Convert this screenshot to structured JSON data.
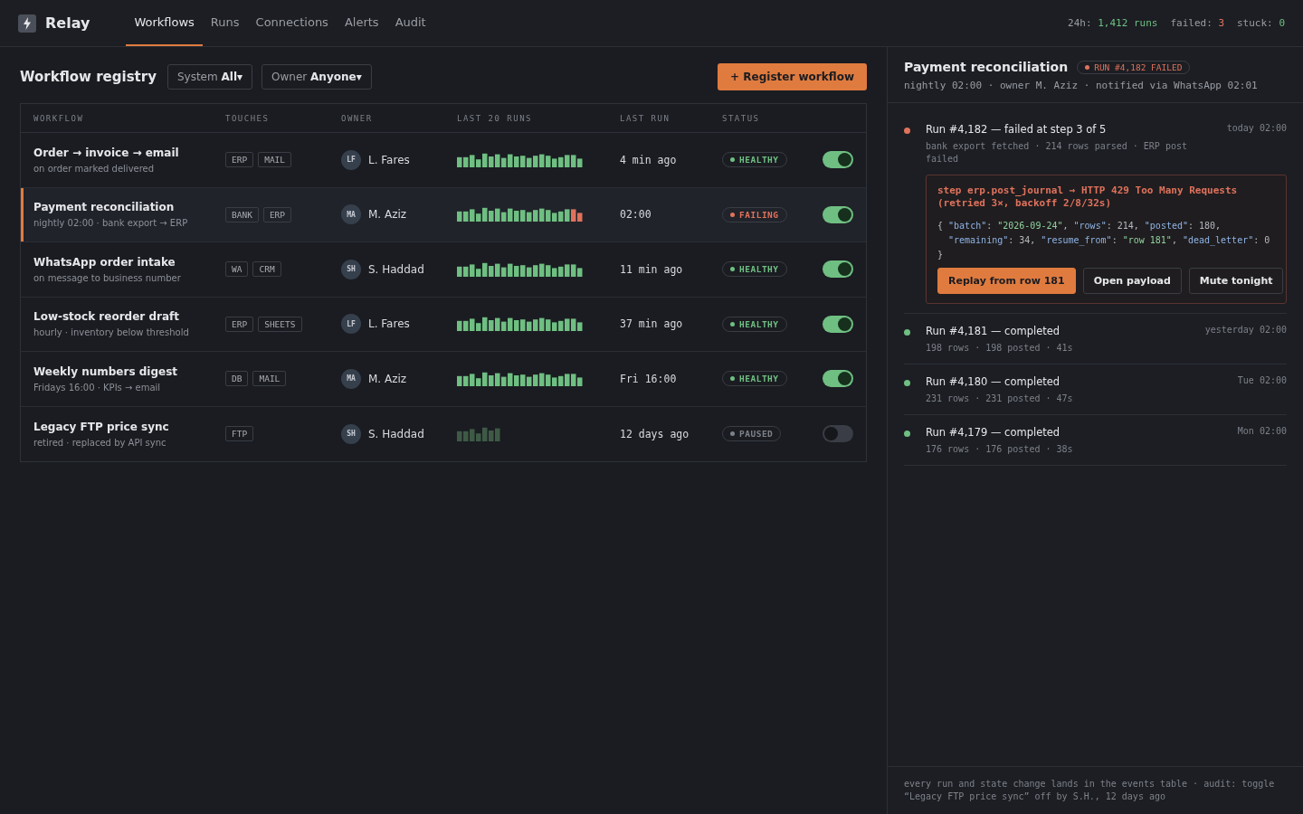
{
  "app": {
    "name": "Relay"
  },
  "nav": [
    {
      "label": "Workflows",
      "selected": true
    },
    {
      "label": "Runs",
      "selected": false
    },
    {
      "label": "Connections",
      "selected": false
    },
    {
      "label": "Alerts",
      "selected": false
    },
    {
      "label": "Audit",
      "selected": false
    }
  ],
  "stats": [
    {
      "label": "24h:",
      "value": "1,412 runs",
      "kind": "ok"
    },
    {
      "label": "failed:",
      "value": "3",
      "kind": "bad"
    },
    {
      "label": "stuck:",
      "value": "0",
      "kind": "ok"
    }
  ],
  "registry": {
    "title": "Workflow registry",
    "filters": [
      {
        "label": "System",
        "value": "All",
        "caret": "▾"
      },
      {
        "label": "Owner",
        "value": "Anyone",
        "caret": "▾"
      }
    ],
    "register_button": "+ Register workflow",
    "columns": [
      "WORKFLOW",
      "TOUCHES",
      "OWNER",
      "LAST 20 RUNS",
      "LAST RUN",
      "STATUS"
    ],
    "rows": [
      {
        "name": "Order → invoice → email",
        "trigger": "on order marked delivered",
        "touches": [
          "ERP",
          "MAIL"
        ],
        "initials": "LF",
        "owner": "L. Fares",
        "recent": [
          {
            "failed": false
          },
          {
            "failed": false
          },
          {
            "failed": false
          },
          {
            "failed": false
          },
          {
            "failed": false
          },
          {
            "failed": false
          },
          {
            "failed": false
          },
          {
            "failed": false
          },
          {
            "failed": false
          },
          {
            "failed": false
          },
          {
            "failed": false
          },
          {
            "failed": false
          },
          {
            "failed": false
          },
          {
            "failed": false
          },
          {
            "failed": false
          },
          {
            "failed": false
          },
          {
            "failed": false
          },
          {
            "failed": false
          },
          {
            "failed": false
          },
          {
            "failed": false
          }
        ],
        "last_run": "4 min ago",
        "status": {
          "label": "HEALTHY",
          "kind": "healthy"
        },
        "on": true,
        "selected": false
      },
      {
        "name": "Payment reconciliation",
        "trigger": "nightly 02:00 · bank export → ERP",
        "touches": [
          "BANK",
          "ERP"
        ],
        "initials": "MA",
        "owner": "M. Aziz",
        "recent": [
          {
            "failed": false
          },
          {
            "failed": false
          },
          {
            "failed": false
          },
          {
            "failed": false
          },
          {
            "failed": false
          },
          {
            "failed": false
          },
          {
            "failed": false
          },
          {
            "failed": false
          },
          {
            "failed": false
          },
          {
            "failed": false
          },
          {
            "failed": false
          },
          {
            "failed": false
          },
          {
            "failed": false
          },
          {
            "failed": false
          },
          {
            "failed": false
          },
          {
            "failed": false
          },
          {
            "failed": false
          },
          {
            "failed": false
          },
          {
            "failed": true
          },
          {
            "failed": true
          }
        ],
        "last_run": "02:00",
        "status": {
          "label": "FAILING",
          "kind": "failing"
        },
        "on": true,
        "selected": true
      },
      {
        "name": "WhatsApp order intake",
        "trigger": "on message to business number",
        "touches": [
          "WA",
          "CRM"
        ],
        "initials": "SH",
        "owner": "S. Haddad",
        "recent": [
          {
            "failed": false
          },
          {
            "failed": false
          },
          {
            "failed": false
          },
          {
            "failed": false
          },
          {
            "failed": false
          },
          {
            "failed": false
          },
          {
            "failed": false
          },
          {
            "failed": false
          },
          {
            "failed": false
          },
          {
            "failed": false
          },
          {
            "failed": false
          },
          {
            "failed": false
          },
          {
            "failed": false
          },
          {
            "failed": false
          },
          {
            "failed": false
          },
          {
            "failed": false
          },
          {
            "failed": false
          },
          {
            "failed": false
          },
          {
            "failed": false
          },
          {
            "failed": false
          }
        ],
        "last_run": "11 min ago",
        "status": {
          "label": "HEALTHY",
          "kind": "healthy"
        },
        "on": true,
        "selected": false
      },
      {
        "name": "Low-stock reorder draft",
        "trigger": "hourly · inventory below threshold",
        "touches": [
          "ERP",
          "SHEETS"
        ],
        "initials": "LF",
        "owner": "L. Fares",
        "recent": [
          {
            "failed": false
          },
          {
            "failed": false
          },
          {
            "failed": false
          },
          {
            "failed": false
          },
          {
            "failed": false
          },
          {
            "failed": false
          },
          {
            "failed": false
          },
          {
            "failed": false
          },
          {
            "failed": false
          },
          {
            "failed": false
          },
          {
            "failed": false
          },
          {
            "failed": false
          },
          {
            "failed": false
          },
          {
            "failed": false
          },
          {
            "failed": false
          },
          {
            "failed": false
          },
          {
            "failed": false
          },
          {
            "failed": false
          },
          {
            "failed": false
          },
          {
            "failed": false
          }
        ],
        "last_run": "37 min ago",
        "status": {
          "label": "HEALTHY",
          "kind": "healthy"
        },
        "on": true,
        "selected": false
      },
      {
        "name": "Weekly numbers digest",
        "trigger": "Fridays 16:00 · KPIs → email",
        "touches": [
          "DB",
          "MAIL"
        ],
        "initials": "MA",
        "owner": "M. Aziz",
        "recent": [
          {
            "failed": false
          },
          {
            "failed": false
          },
          {
            "failed": false
          },
          {
            "failed": false
          },
          {
            "failed": false
          },
          {
            "failed": false
          },
          {
            "failed": false
          },
          {
            "failed": false
          },
          {
            "failed": false
          },
          {
            "failed": false
          },
          {
            "failed": false
          },
          {
            "failed": false
          },
          {
            "failed": false
          },
          {
            "failed": false
          },
          {
            "failed": false
          },
          {
            "failed": false
          },
          {
            "failed": false
          },
          {
            "failed": false
          },
          {
            "failed": false
          },
          {
            "failed": false
          }
        ],
        "last_run": "Fri 16:00",
        "status": {
          "label": "HEALTHY",
          "kind": "healthy"
        },
        "on": true,
        "selected": false
      },
      {
        "name": "Legacy FTP price sync",
        "trigger": "retired · replaced by API sync",
        "touches": [
          "FTP"
        ],
        "initials": "SH",
        "owner": "S. Haddad",
        "recent": [
          {
            "failed": false
          },
          {
            "failed": false
          },
          {
            "failed": false
          },
          {
            "failed": false
          },
          {
            "failed": false
          },
          {
            "failed": false
          },
          {
            "failed": false
          }
        ],
        "last_run": "12 days ago",
        "status": {
          "label": "PAUSED",
          "kind": "paused"
        },
        "on": false,
        "selected": false
      }
    ]
  },
  "detail": {
    "title": "Payment reconciliation",
    "badge": "RUN #4,182 FAILED",
    "subtitle": "nightly 02:00 · owner M. Aziz · notified via WhatsApp 02:01",
    "runs": [
      {
        "title": "Run #4,182 — failed at step 3 of 5",
        "time": "today 02:00",
        "summary": "bank export fetched · 214 rows parsed · ERP post failed",
        "kind": "failed",
        "error": {
          "message": "step erp.post_journal → HTTP 429 Too Many Requests (retried 3×, backoff 2/8/32s)",
          "payload": [
            {
              "indent": false,
              "tokens": [
                {
                  "t": "{ ",
                  "kind": "punct"
                },
                {
                  "t": "\"batch\"",
                  "kind": "key"
                },
                {
                  "t": ": ",
                  "kind": "punct"
                },
                {
                  "t": "\"2026-09-24\"",
                  "kind": "str"
                },
                {
                  "t": ", ",
                  "kind": "punct"
                },
                {
                  "t": "\"rows\"",
                  "kind": "key"
                },
                {
                  "t": ": 214, ",
                  "kind": "punct"
                },
                {
                  "t": "\"posted\"",
                  "kind": "key"
                },
                {
                  "t": ": 180,",
                  "kind": "punct"
                }
              ]
            },
            {
              "indent": true,
              "tokens": [
                {
                  "t": "\"remaining\"",
                  "kind": "key"
                },
                {
                  "t": ": 34, ",
                  "kind": "punct"
                },
                {
                  "t": "\"resume_from\"",
                  "kind": "key"
                },
                {
                  "t": ": ",
                  "kind": "punct"
                },
                {
                  "t": "\"row 181\"",
                  "kind": "str"
                },
                {
                  "t": ", ",
                  "kind": "punct"
                },
                {
                  "t": "\"dead_letter\"",
                  "kind": "key"
                },
                {
                  "t": ": 0",
                  "kind": "punct"
                }
              ]
            },
            {
              "indent": false,
              "tokens": [
                {
                  "t": "}",
                  "kind": "punct"
                }
              ]
            }
          ],
          "actions": [
            {
              "label": "Replay from row 181",
              "kind": "primary"
            },
            {
              "label": "Open payload",
              "kind": "secondary"
            },
            {
              "label": "Mute tonight",
              "kind": "secondary"
            }
          ]
        }
      },
      {
        "title": "Run #4,181 — completed",
        "time": "yesterday 02:00",
        "summary": "198 rows · 198 posted · 41s",
        "kind": "completed"
      },
      {
        "title": "Run #4,180 — completed",
        "time": "Tue 02:00",
        "summary": "231 rows · 231 posted · 47s",
        "kind": "completed"
      },
      {
        "title": "Run #4,179 — completed",
        "time": "Mon 02:00",
        "summary": "176 rows · 176 posted · 38s",
        "kind": "completed"
      }
    ],
    "footer": "every run and state change lands in the events table · audit: toggle “Legacy FTP price sync” off by S.H., 12 days ago"
  }
}
